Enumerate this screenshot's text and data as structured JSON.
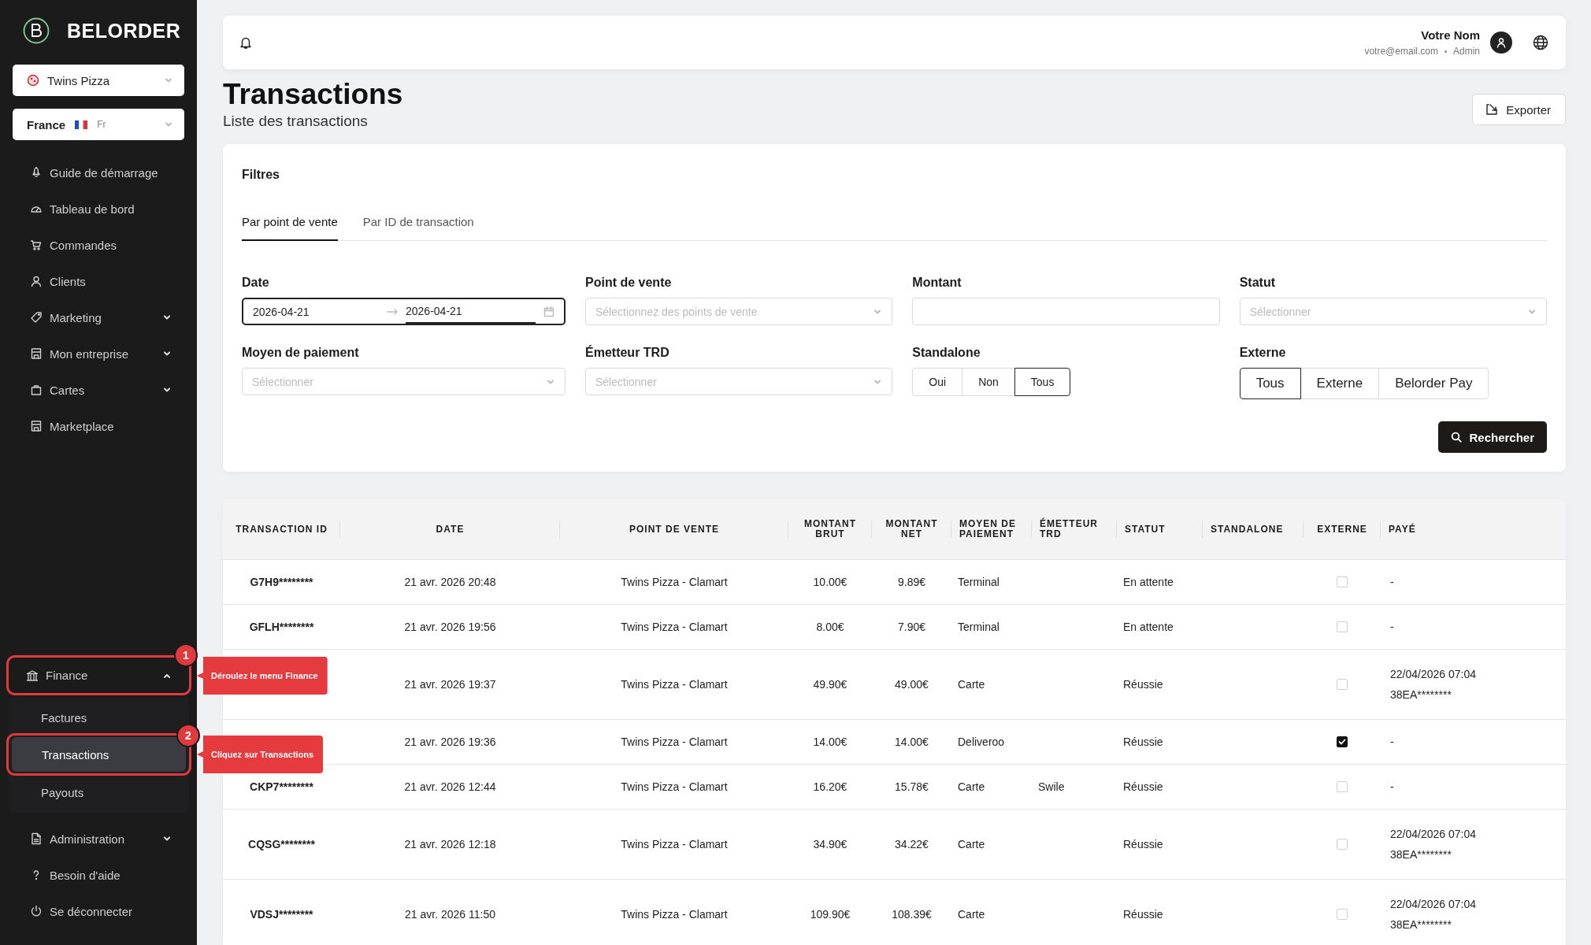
{
  "brand": {
    "name": "BELORDER"
  },
  "store_select": {
    "value": "Twins Pizza"
  },
  "country_select": {
    "country": "France",
    "language": "Fr"
  },
  "nav": [
    {
      "label": "Guide de démarrage",
      "expandable": false
    },
    {
      "label": "Tableau de bord",
      "expandable": false
    },
    {
      "label": "Commandes",
      "expandable": false
    },
    {
      "label": "Clients",
      "expandable": false
    },
    {
      "label": "Marketing",
      "expandable": true,
      "expanded": false
    },
    {
      "label": "Mon entreprise",
      "expandable": true,
      "expanded": false
    },
    {
      "label": "Cartes",
      "expandable": true,
      "expanded": false
    },
    {
      "label": "Marketplace",
      "expandable": false
    }
  ],
  "bottom_nav": [
    {
      "label": "Finance",
      "expandable": true,
      "expanded": true,
      "callout": {
        "number": "1",
        "text": "Déroulez le menu Finance"
      },
      "children": [
        {
          "label": "Factures",
          "selected": false
        },
        {
          "label": "Transactions",
          "selected": true,
          "callout": {
            "number": "2",
            "text": "Cliquez sur Transactions"
          }
        },
        {
          "label": "Payouts",
          "selected": false
        }
      ]
    },
    {
      "label": "Administration",
      "expandable": true,
      "expanded": false
    },
    {
      "label": "Besoin d'aide",
      "expandable": false
    },
    {
      "label": "Se déconnecter",
      "expandable": false
    }
  ],
  "header": {
    "user_name": "Votre Nom",
    "email": "votre@email.com",
    "role": "Admin"
  },
  "page": {
    "title": "Transactions",
    "subtitle": "Liste des transactions",
    "export_button": "Exporter"
  },
  "filters": {
    "title": "Filtres",
    "tabs": [
      {
        "label": "Par point de vente",
        "selected": true
      },
      {
        "label": "Par ID de transaction",
        "selected": false
      }
    ],
    "fields": [
      {
        "kind": "daterange",
        "label": "Date",
        "start": "2026-04-21",
        "end": "2026-04-21",
        "focused": true
      },
      {
        "kind": "select",
        "label": "Point de vente",
        "placeholder": "Sélectionnez des points de vente"
      },
      {
        "kind": "input",
        "label": "Montant"
      },
      {
        "kind": "select",
        "label": "Statut",
        "placeholder": "Sélectionner"
      },
      {
        "kind": "select",
        "label": "Moyen de paiement",
        "placeholder": "Sélectionner"
      },
      {
        "kind": "select",
        "label": "Émetteur TRD",
        "placeholder": "Sélectionner"
      },
      {
        "kind": "segmented",
        "label": "Standalone",
        "options": [
          {
            "label": "Oui",
            "selected": false
          },
          {
            "label": "Non",
            "selected": false
          },
          {
            "label": "Tous",
            "selected": true
          }
        ]
      },
      {
        "kind": "toggle_group",
        "label": "Externe",
        "options": [
          {
            "label": "Tous",
            "selected": true
          },
          {
            "label": "Externe",
            "selected": false
          },
          {
            "label": "Belorder Pay",
            "selected": false
          }
        ]
      }
    ],
    "search_button": "Rechercher"
  },
  "table": {
    "columns": [
      "TRANSACTION ID",
      "DATE",
      "POINT DE VENTE",
      "MONTANT BRUT",
      "MONTANT NET",
      "MOYEN DE PAIEMENT",
      "ÉMETTEUR TRD",
      "STATUT",
      "STANDALONE",
      "EXTERNE",
      "PAYÉ"
    ],
    "rows": [
      {
        "id": "G7H9********",
        "date": "21 avr. 2026 20:48",
        "point_de_vente": "Twins Pizza - Clamart",
        "brut": "10.00€",
        "net": "9.89€",
        "moyen": "Terminal",
        "statut": "En attente",
        "externe": false,
        "paye": [
          "-"
        ]
      },
      {
        "id": "GFLH********",
        "date": "21 avr. 2026 19:56",
        "point_de_vente": "Twins Pizza - Clamart",
        "brut": "8.00€",
        "net": "7.90€",
        "moyen": "Terminal",
        "statut": "En attente",
        "externe": false,
        "paye": [
          "-"
        ]
      },
      {
        "date": "21 avr. 2026 19:37",
        "point_de_vente": "Twins Pizza - Clamart",
        "brut": "49.90€",
        "net": "49.00€",
        "moyen": "Carte",
        "statut": "Réussie",
        "externe": false,
        "paye": [
          "22/04/2026 07:04",
          "38EA********"
        ]
      },
      {
        "date": "21 avr. 2026 19:36",
        "point_de_vente": "Twins Pizza - Clamart",
        "brut": "14.00€",
        "net": "14.00€",
        "moyen": "Deliveroo",
        "statut": "Réussie",
        "externe": true,
        "paye": [
          "-"
        ]
      },
      {
        "id": "CKP7********",
        "date": "21 avr. 2026 12:44",
        "point_de_vente": "Twins Pizza - Clamart",
        "brut": "16.20€",
        "net": "15.78€",
        "moyen": "Carte",
        "emetteur": "Swile",
        "statut": "Réussie",
        "externe": false,
        "paye": [
          "-"
        ]
      },
      {
        "id": "CQSG********",
        "date": "21 avr. 2026 12:18",
        "point_de_vente": "Twins Pizza - Clamart",
        "brut": "34.90€",
        "net": "34.22€",
        "moyen": "Carte",
        "statut": "Réussie",
        "externe": false,
        "paye": [
          "22/04/2026 07:04",
          "38EA********"
        ]
      },
      {
        "id": "VDSJ********",
        "date": "21 avr. 2026 11:50",
        "point_de_vente": "Twins Pizza - Clamart",
        "brut": "109.90€",
        "net": "108.39€",
        "moyen": "Carte",
        "statut": "Réussie",
        "externe": false,
        "paye": [
          "22/04/2026 07:04",
          "38EA********"
        ]
      }
    ]
  }
}
